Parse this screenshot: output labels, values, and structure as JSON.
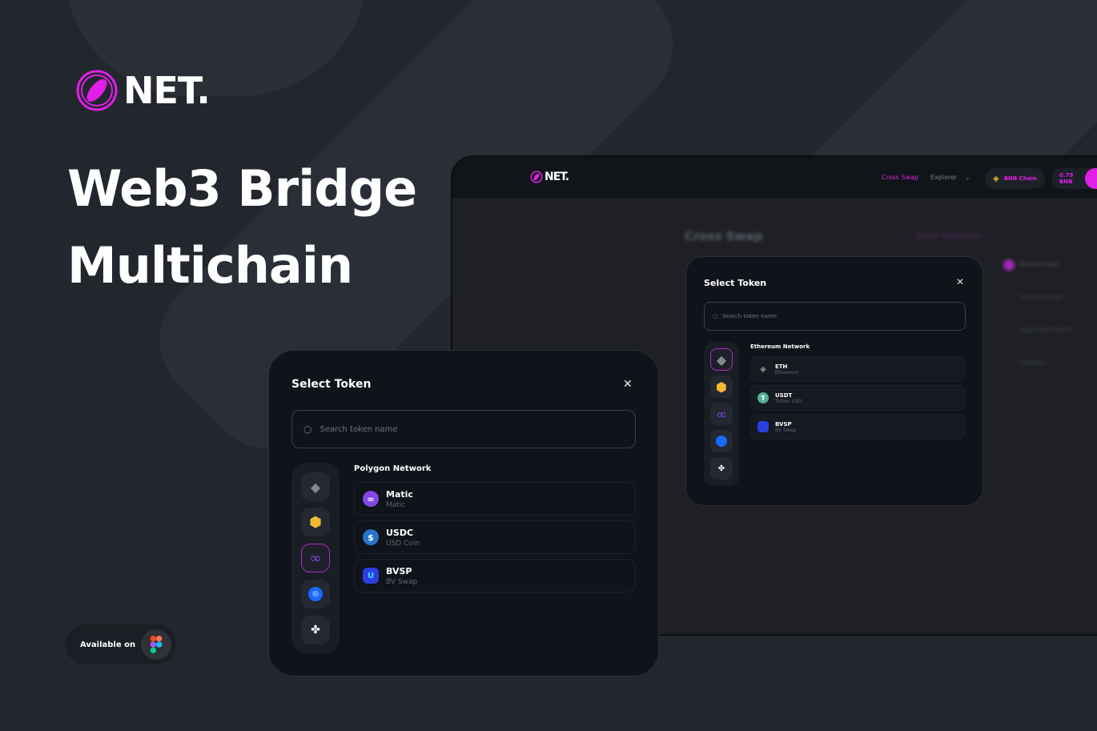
{
  "brand": {
    "name": "NET.",
    "accent": "#e21ee8"
  },
  "hero": {
    "line1": "Web3 Bridge",
    "line2": "Multichain"
  },
  "badge": {
    "label": "Available on",
    "icon": "figma-icon"
  },
  "app": {
    "nav": [
      {
        "label": "Cross Swap",
        "active": true
      },
      {
        "label": "Explorer"
      }
    ],
    "chain_pill": "BNB Chain",
    "balance_pill": "0.79 BNB",
    "page_title": "Cross Swap",
    "recent_link": "Recent Transactions",
    "steps": [
      "Starting Swap",
      "Crossing Bridge",
      "Approving Transfer",
      "Complete"
    ],
    "modal": {
      "title": "Select Token",
      "search_placeholder": "Search token name",
      "network": "Ethereum Network",
      "selected_chain": "ethereum",
      "tokens": [
        {
          "symbol": "ETH",
          "name": "Ethereum"
        },
        {
          "symbol": "USDT",
          "name": "Tether USD"
        },
        {
          "symbol": "BVSP",
          "name": "BV Swap"
        }
      ]
    }
  },
  "front_modal": {
    "title": "Select Token",
    "search_placeholder": "Search token name",
    "network": "Polygon Network",
    "selected_chain": "polygon",
    "chains": [
      "ethereum",
      "bnb",
      "polygon",
      "fantom",
      "cronos"
    ],
    "tokens": [
      {
        "symbol": "Matic",
        "name": "Matic"
      },
      {
        "symbol": "USDC",
        "name": "USD Coin"
      },
      {
        "symbol": "BVSP",
        "name": "BV Swap"
      }
    ]
  }
}
